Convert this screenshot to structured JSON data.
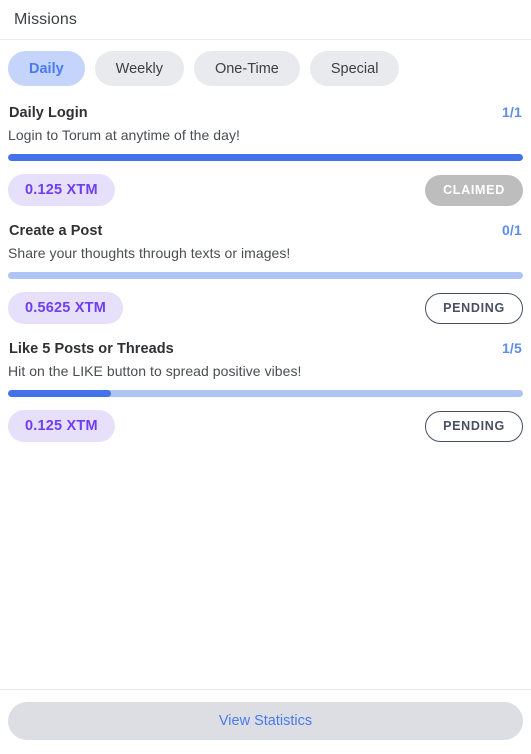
{
  "header": {
    "title": "Missions"
  },
  "tabs": [
    {
      "label": "Daily",
      "active": true
    },
    {
      "label": "Weekly",
      "active": false
    },
    {
      "label": "One-Time",
      "active": false
    },
    {
      "label": "Special",
      "active": false
    }
  ],
  "missions": [
    {
      "title": "Daily Login",
      "description": "Login to Torum at anytime of the day!",
      "counter": "1/1",
      "progress_percent": 100,
      "reward": "0.125 XTM",
      "status": "CLAIMED",
      "status_type": "claimed"
    },
    {
      "title": "Create a Post",
      "description": "Share your thoughts through texts or images!",
      "counter": "0/1",
      "progress_percent": 0,
      "reward": "0.5625 XTM",
      "status": "PENDING",
      "status_type": "pending"
    },
    {
      "title": "Like 5 Posts or Threads",
      "description": "Hit on the LIKE button to spread positive vibes!",
      "counter": "1/5",
      "progress_percent": 20,
      "reward": "0.125 XTM",
      "status": "PENDING",
      "status_type": "pending"
    }
  ],
  "footer": {
    "view_statistics_label": "View Statistics"
  },
  "colors": {
    "accent_blue": "#4472e8",
    "tab_active_bg": "#c4d4fa",
    "tab_active_text": "#4a7af0",
    "tab_inactive_bg": "#e8eaed",
    "progress_track": "#aec4f3",
    "reward_chip_bg": "#e7e0fa",
    "reward_chip_text": "#6f3df2",
    "claimed_bg": "#bdbdbd",
    "pending_border": "#474f63",
    "footer_btn_bg": "#dcdee3",
    "counter_text": "#5b8def"
  }
}
